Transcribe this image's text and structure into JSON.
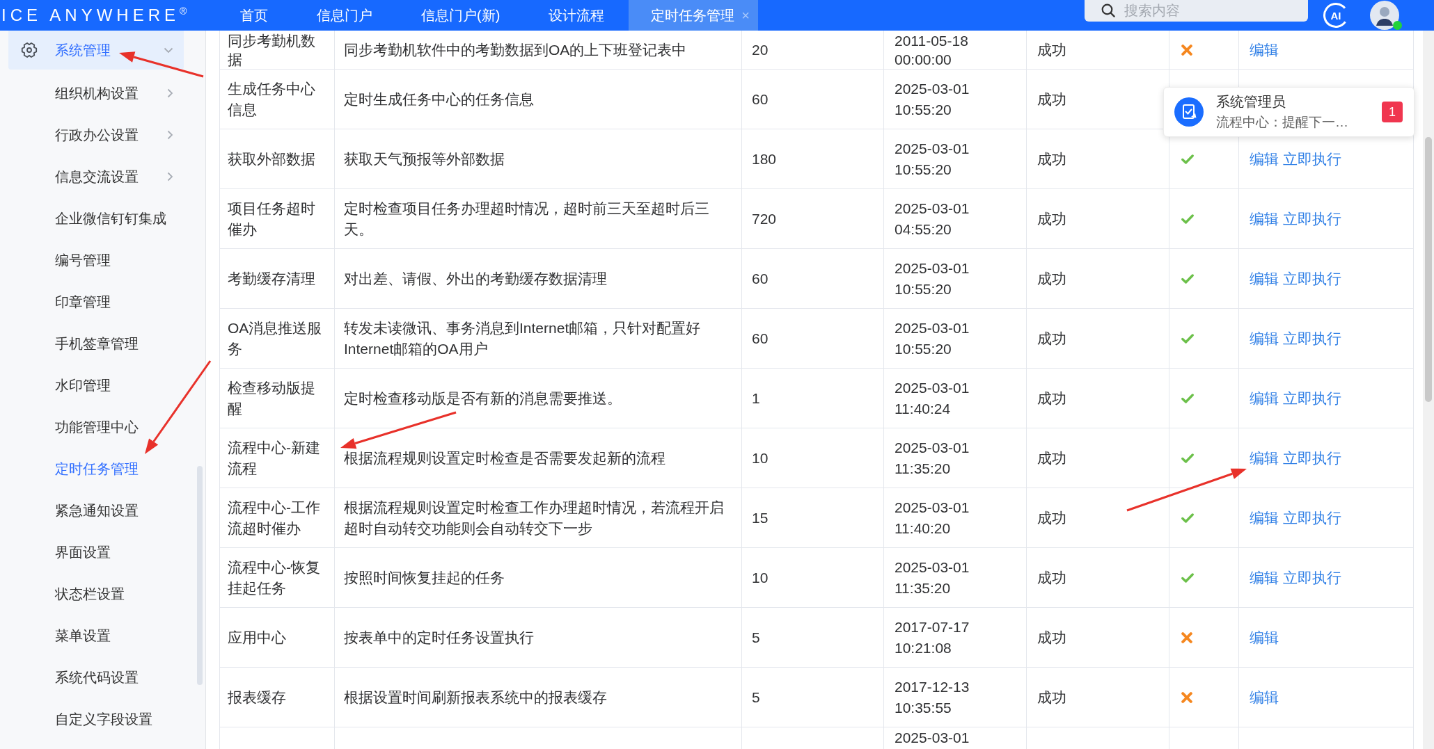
{
  "header": {
    "logo": "ICE ANYWHERE$^{®}$",
    "tabs": [
      {
        "label": "首页",
        "selected": false
      },
      {
        "label": "信息门户",
        "selected": false
      },
      {
        "label": "信息门户(新)",
        "selected": false
      },
      {
        "label": "设计流程",
        "selected": false
      },
      {
        "label": "定时任务管理",
        "selected": true,
        "close": "×"
      }
    ],
    "search": {
      "placeholder": "搜索内容"
    },
    "ai_button": {
      "label": "AI"
    }
  },
  "sidebar": {
    "groups": [
      {
        "label": "系统管理",
        "selected": true,
        "expanded": true,
        "children": [
          {
            "label": "组织机构设置",
            "kind": "submenu",
            "selected": false
          },
          {
            "label": "行政办公设置",
            "kind": "submenu",
            "selected": false
          },
          {
            "label": "信息交流设置",
            "kind": "submenu",
            "selected": false
          },
          {
            "label": "企业微信钉钉集成",
            "kind": "page",
            "selected": false
          },
          {
            "label": "编号管理",
            "kind": "page",
            "selected": false
          },
          {
            "label": "印章管理",
            "kind": "page",
            "selected": false
          },
          {
            "label": "手机签章管理",
            "kind": "page",
            "selected": false
          },
          {
            "label": "水印管理",
            "kind": "page",
            "selected": false
          },
          {
            "label": "功能管理中心",
            "kind": "page",
            "selected": false
          },
          {
            "label": "定时任务管理",
            "kind": "page",
            "selected": true
          },
          {
            "label": "紧急通知设置",
            "kind": "page",
            "selected": false
          },
          {
            "label": "界面设置",
            "kind": "page",
            "selected": false
          },
          {
            "label": "状态栏设置",
            "kind": "page",
            "selected": false
          },
          {
            "label": "菜单设置",
            "kind": "page",
            "selected": false
          },
          {
            "label": "系统代码设置",
            "kind": "page",
            "selected": false
          },
          {
            "label": "自定义字段设置",
            "kind": "page",
            "selected": false
          }
        ]
      }
    ]
  },
  "table": {
    "rows": [
      {
        "column_1": "同步考勤机数据",
        "column_2": "同步考勤机软件中的考勤数据到OA的上下班登记表中",
        "column_3": "20",
        "column_4": "2011-05-18 00:00:00",
        "column_5": "成功",
        "ok": false,
        "links": [
          "编辑"
        ]
      },
      {
        "column_1": "生成任务中心信息",
        "column_2": "定时生成任务中心的任务信息",
        "column_3": "60",
        "column_4": "2025-03-01 10:55:20",
        "column_5": "成功"
      },
      {
        "column_1": "获取外部数据",
        "column_2": "获取天气预报等外部数据",
        "column_3": "180",
        "column_4": "2025-03-01 10:55:20",
        "column_5": "成功",
        "ok": true,
        "links": [
          "编辑",
          "立即执行"
        ]
      },
      {
        "column_1": "项目任务超时催办",
        "column_2": "定时检查项目任务办理超时情况，超时前三天至超时后三天。",
        "column_3": "720",
        "column_4": "2025-03-01 04:55:20",
        "column_5": "成功",
        "ok": true,
        "links": [
          "编辑",
          "立即执行"
        ]
      },
      {
        "column_1": "考勤缓存清理",
        "column_2": "对出差、请假、外出的考勤缓存数据清理",
        "column_3": "60",
        "column_4": "2025-03-01 10:55:20",
        "column_5": "成功",
        "ok": true,
        "links": [
          "编辑",
          "立即执行"
        ]
      },
      {
        "column_1": "OA消息推送服务",
        "column_2": "转发未读微讯、事务消息到Internet邮箱，只针对配置好Internet邮箱的OA用户",
        "column_3": "60",
        "column_4": "2025-03-01 10:55:20",
        "column_5": "成功",
        "ok": true,
        "links": [
          "编辑",
          "立即执行"
        ]
      },
      {
        "column_1": "检查移动版提醒",
        "column_2": "定时检查移动版是否有新的消息需要推送。",
        "column_3": "1",
        "column_4": "2025-03-01 11:40:24",
        "column_5": "成功",
        "ok": true,
        "links": [
          "编辑",
          "立即执行"
        ]
      },
      {
        "column_1": "流程中心-新建流程",
        "column_2": "根据流程规则设置定时检查是否需要发起新的流程",
        "column_3": "10",
        "column_4": "2025-03-01 11:35:20",
        "column_5": "成功",
        "ok": true,
        "links": [
          "编辑",
          "立即执行"
        ]
      },
      {
        "column_1": "流程中心-工作流超时催办",
        "column_2": "根据流程规则设置定时检查工作办理超时情况，若流程开启超时自动转交功能则会自动转交下一步",
        "column_3": "15",
        "column_4": "2025-03-01 11:40:20",
        "column_5": "成功",
        "ok": true,
        "links": [
          "编辑",
          "立即执行"
        ]
      },
      {
        "column_1": "流程中心-恢复挂起任务",
        "column_2": "按照时间恢复挂起的任务",
        "column_3": "10",
        "column_4": "2025-03-01 11:35:20",
        "column_5": "成功",
        "ok": true,
        "links": [
          "编辑",
          "立即执行"
        ]
      },
      {
        "column_1": "应用中心",
        "column_2": "按表单中的定时任务设置执行",
        "column_3": "5",
        "column_4": "2017-07-17 10:21:08",
        "column_5": "成功",
        "ok": false,
        "links": [
          "编辑"
        ]
      },
      {
        "column_1": "报表缓存",
        "column_2": "根据设置时间刷新报表系统中的报表缓存",
        "column_3": "5",
        "column_4": "2017-12-13 10:35:55",
        "column_5": "成功",
        "ok": false,
        "links": [
          "编辑"
        ]
      },
      {
        "column_4": "2025-03-01"
      }
    ]
  },
  "notification": {
    "title": "系统管理员",
    "message": "流程中心：提醒下一…",
    "count": "1"
  }
}
